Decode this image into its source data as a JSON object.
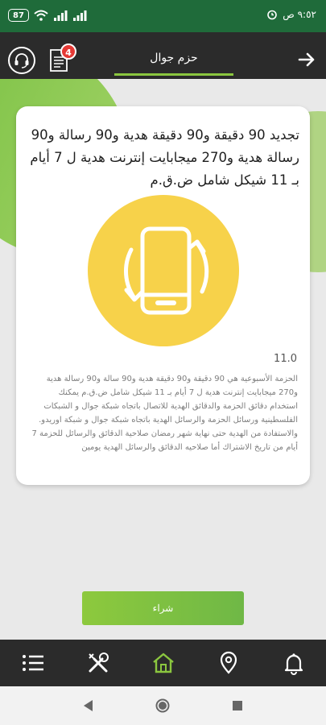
{
  "status_bar": {
    "battery": "87",
    "time": "٩:٥٢ ص",
    "colors": {
      "background": "#1f6b3a"
    }
  },
  "header": {
    "title": "حزم جوال",
    "notification_count": "4",
    "icons": [
      "headset-icon",
      "document-icon",
      "arrow-right-icon"
    ],
    "colors": {
      "background": "#2b2b2b",
      "accent": "#8bc63f",
      "badge": "#e53935"
    }
  },
  "card": {
    "headline": "تجديد 90 دقيقة و90 دقيقة هدية  و90 رسالة و90 رسالة هدية و270 ميجابايت إنترنت هدية ل 7 أيام بـ 11 شيكل شامل ض.ق.م",
    "price": "11.0",
    "description": "الحزمة الأسبوعية هي  90 دقيقة و90 دقيقة هدية  و90 سالة و90 رسالة هدية و270 ميجابايت إنترنت هدية   ل 7 أيام بـ 11 شيكل شامل ض.ق.م يمكنك استخدام دقائق الحزمة والدقائق الهدية  للاتصال باتجاه شبكة جوال و الشبكات الفلسطينية ورسائل الحزمة والرسائل الهدية باتجاه شبكة جوال و شبكة اوريدو. والاستفادة من الهدية حتى نهاية شهر رمضان صلاحية الدقائق والرسائل للحزمة  7 أيام من تاريخ الاشتراك أما صلاحيه الدقائق والرسائل الهدية يومين",
    "icon": "phone-renew-icon",
    "colors": {
      "circle": "#f7d24a"
    }
  },
  "buy_button": {
    "label": "شراء",
    "color": "#7dc142"
  },
  "bottom_nav": {
    "items": [
      "menu-icon",
      "tools-icon",
      "home-icon",
      "location-icon",
      "bell-icon"
    ],
    "active": "home-icon",
    "colors": {
      "active": "#8bc63f",
      "inactive": "#ffffff"
    }
  },
  "system_nav": {
    "items": [
      "back-icon",
      "home-icon",
      "recents-icon"
    ]
  }
}
